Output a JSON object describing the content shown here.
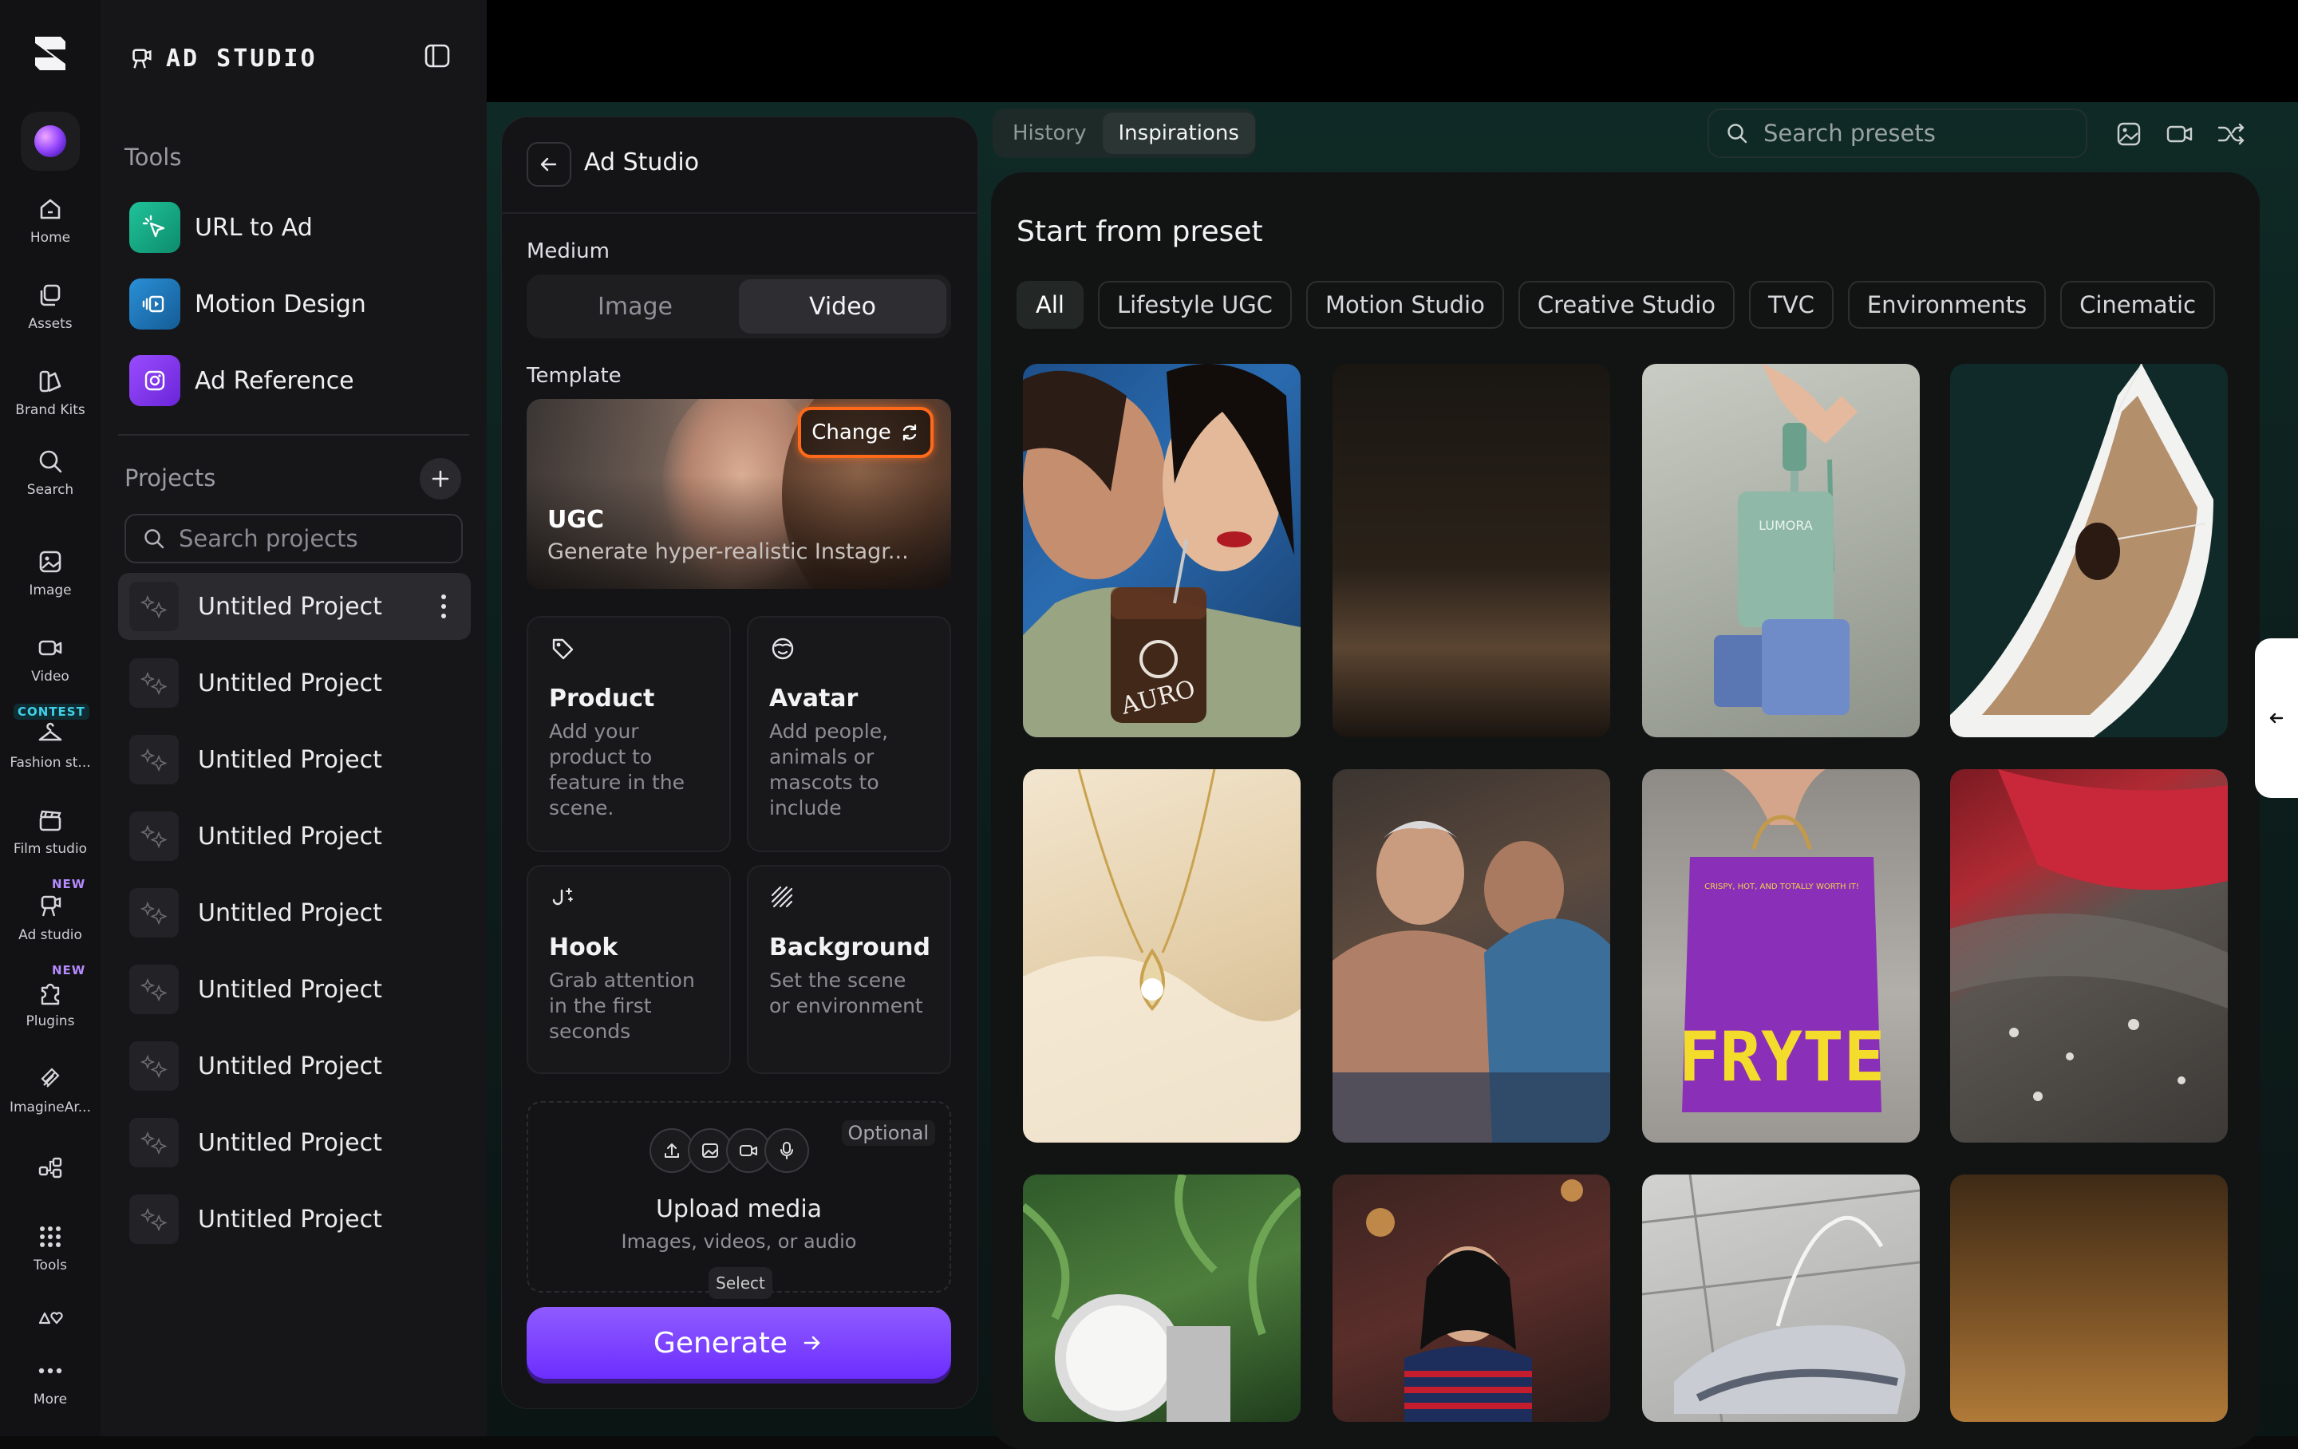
{
  "rail": {
    "items": [
      {
        "label": "Home",
        "icon": "home-icon"
      },
      {
        "label": "Assets",
        "icon": "assets-icon"
      },
      {
        "label": "Brand Kits",
        "icon": "brand-kits-icon"
      },
      {
        "label": "Search",
        "icon": "search-icon"
      },
      {
        "label": "Image",
        "icon": "image-icon"
      },
      {
        "label": "Video",
        "icon": "video-icon",
        "badge": "CONTEST"
      },
      {
        "label": "Fashion st...",
        "icon": "hanger-icon"
      },
      {
        "label": "Film studio",
        "icon": "clapper-icon",
        "badge": "NEW"
      },
      {
        "label": "Ad studio",
        "icon": "ad-studio-icon",
        "badge": "NEW"
      },
      {
        "label": "Plugins",
        "icon": "puzzle-icon"
      },
      {
        "label": "ImagineAr...",
        "icon": "imagineart-icon"
      },
      {
        "label": "",
        "icon": "nodes-icon"
      },
      {
        "label": "Tools",
        "icon": "grid-icon"
      },
      {
        "label": "",
        "icon": "shapes-icon"
      },
      {
        "label": "More",
        "icon": "more-icon"
      }
    ]
  },
  "sidebar": {
    "brand_title": "AD STUDIO",
    "tools_heading": "Tools",
    "tools": [
      {
        "label": "URL to Ad",
        "color": "#14b38a"
      },
      {
        "label": "Motion Design",
        "color": "#1c7fc4"
      },
      {
        "label": "Ad Reference",
        "color": "#8a3cf0"
      }
    ],
    "projects_heading": "Projects",
    "search_placeholder": "Search projects",
    "projects": [
      "Untitled Project",
      "Untitled Project",
      "Untitled Project",
      "Untitled Project",
      "Untitled Project",
      "Untitled Project",
      "Untitled Project",
      "Untitled Project",
      "Untitled Project"
    ]
  },
  "panel": {
    "title": "Ad Studio",
    "medium_label": "Medium",
    "medium_options": [
      "Image",
      "Video"
    ],
    "medium_selected": "Video",
    "template_label": "Template",
    "template_name": "UGC",
    "template_desc": "Generate hyper-realistic Instagr...",
    "change_label": "Change",
    "options": [
      {
        "title": "Product",
        "desc": "Add your product to feature in the scene.",
        "icon": "tag-icon"
      },
      {
        "title": "Avatar",
        "desc": "Add people, animals or mascots to include",
        "icon": "face-icon"
      },
      {
        "title": "Hook",
        "desc": "Grab attention in the first seconds",
        "icon": "hook-icon"
      },
      {
        "title": "Background",
        "desc": "Set the scene or environment",
        "icon": "hatch-icon"
      }
    ],
    "upload_optional": "Optional",
    "upload_title": "Upload media",
    "upload_sub": "Images, videos, or audio",
    "upload_select": "Select",
    "generate_label": "Generate"
  },
  "main": {
    "tabs": [
      "History",
      "Inspirations"
    ],
    "tab_selected": "Inspirations",
    "search_placeholder": "Search presets",
    "preset_title": "Start from preset",
    "chips": [
      "All",
      "Lifestyle UGC",
      "Motion Studio",
      "Creative Studio",
      "TVC",
      "Environments",
      "Cinematic"
    ],
    "chip_selected": "All",
    "tile_texts": {
      "auro": "AURO",
      "lumora": "LUMORA",
      "fryte": "FRYTE",
      "fryte_tag": "CRISPY, HOT, AND TOTALLY WORTH IT!"
    }
  },
  "colors": {
    "accent": "#7b3cff",
    "change_outline": "#ff6a1a"
  }
}
